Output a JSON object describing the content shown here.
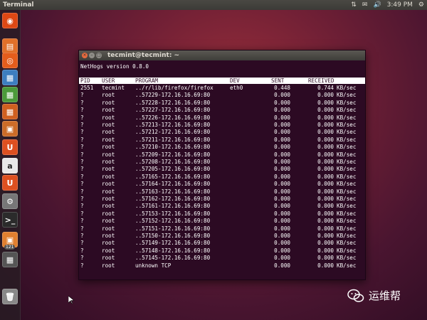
{
  "top_panel": {
    "app_name": "Terminal",
    "clock": "3:49 PM"
  },
  "launcher": {
    "items": [
      {
        "icon": "dash-home-icon",
        "color": "#dd4814"
      },
      {
        "icon": "files-icon",
        "color": "#e0702a"
      },
      {
        "icon": "firefox-icon",
        "color": "#e35d1c"
      },
      {
        "icon": "writer-icon",
        "color": "#3d7ebf"
      },
      {
        "icon": "calc-icon",
        "color": "#4c9a3a"
      },
      {
        "icon": "impress-icon",
        "color": "#d06020"
      },
      {
        "icon": "software-center-icon",
        "color": "#cc6c28"
      },
      {
        "icon": "ubuntu-one-icon",
        "color": "#dd5020"
      },
      {
        "icon": "amazon-icon",
        "color": "#e8e8e8"
      },
      {
        "icon": "ubuntu-one-music-icon",
        "color": "#dd5020"
      },
      {
        "icon": "system-settings-icon",
        "color": "#777777"
      },
      {
        "icon": "terminal-icon",
        "color": "#2b2b2b"
      },
      {
        "icon": "update-manager-icon",
        "color": "#e08030"
      },
      {
        "icon": "workspaces-icon",
        "color": "#555555"
      },
      {
        "icon": "trash-icon",
        "color": "#888888"
      }
    ],
    "badge": "121"
  },
  "terminal": {
    "title": "tecmint@tecmint: ~",
    "version_line": "NetHogs version 0.8.0",
    "columns": [
      "PID",
      "USER",
      "PROGRAM",
      "DEV",
      "SENT",
      "RECEIVED"
    ],
    "rows": [
      {
        "pid": "2551",
        "user": "tecmint",
        "program": "../r/lib/firefox/firefox",
        "dev": "eth0",
        "sent": "0.448",
        "received": "0.744",
        "unit": "KB/sec"
      },
      {
        "pid": "?",
        "user": "root",
        "program": "..57229-172.16.16.69:80",
        "dev": "",
        "sent": "0.000",
        "received": "0.000",
        "unit": "KB/sec"
      },
      {
        "pid": "?",
        "user": "root",
        "program": "..57228-172.16.16.69:80",
        "dev": "",
        "sent": "0.000",
        "received": "0.000",
        "unit": "KB/sec"
      },
      {
        "pid": "?",
        "user": "root",
        "program": "..57227-172.16.16.69:80",
        "dev": "",
        "sent": "0.000",
        "received": "0.000",
        "unit": "KB/sec"
      },
      {
        "pid": "?",
        "user": "root",
        "program": "..57226-172.16.16.69:80",
        "dev": "",
        "sent": "0.000",
        "received": "0.000",
        "unit": "KB/sec"
      },
      {
        "pid": "?",
        "user": "root",
        "program": "..57213-172.16.16.69:80",
        "dev": "",
        "sent": "0.000",
        "received": "0.000",
        "unit": "KB/sec"
      },
      {
        "pid": "?",
        "user": "root",
        "program": "..57212-172.16.16.69:80",
        "dev": "",
        "sent": "0.000",
        "received": "0.000",
        "unit": "KB/sec"
      },
      {
        "pid": "?",
        "user": "root",
        "program": "..57211-172.16.16.69:80",
        "dev": "",
        "sent": "0.000",
        "received": "0.000",
        "unit": "KB/sec"
      },
      {
        "pid": "?",
        "user": "root",
        "program": "..57210-172.16.16.69:80",
        "dev": "",
        "sent": "0.000",
        "received": "0.000",
        "unit": "KB/sec"
      },
      {
        "pid": "?",
        "user": "root",
        "program": "..57209-172.16.16.69:80",
        "dev": "",
        "sent": "0.000",
        "received": "0.000",
        "unit": "KB/sec"
      },
      {
        "pid": "?",
        "user": "root",
        "program": "..57208-172.16.16.69:80",
        "dev": "",
        "sent": "0.000",
        "received": "0.000",
        "unit": "KB/sec"
      },
      {
        "pid": "?",
        "user": "root",
        "program": "..57205-172.16.16.69:80",
        "dev": "",
        "sent": "0.000",
        "received": "0.000",
        "unit": "KB/sec"
      },
      {
        "pid": "?",
        "user": "root",
        "program": "..57165-172.16.16.69:80",
        "dev": "",
        "sent": "0.000",
        "received": "0.000",
        "unit": "KB/sec"
      },
      {
        "pid": "?",
        "user": "root",
        "program": "..57164-172.16.16.69:80",
        "dev": "",
        "sent": "0.000",
        "received": "0.000",
        "unit": "KB/sec"
      },
      {
        "pid": "?",
        "user": "root",
        "program": "..57163-172.16.16.69:80",
        "dev": "",
        "sent": "0.000",
        "received": "0.000",
        "unit": "KB/sec"
      },
      {
        "pid": "?",
        "user": "root",
        "program": "..57162-172.16.16.69:80",
        "dev": "",
        "sent": "0.000",
        "received": "0.000",
        "unit": "KB/sec"
      },
      {
        "pid": "?",
        "user": "root",
        "program": "..57161-172.16.16.69:80",
        "dev": "",
        "sent": "0.000",
        "received": "0.000",
        "unit": "KB/sec"
      },
      {
        "pid": "?",
        "user": "root",
        "program": "..57153-172.16.16.69:80",
        "dev": "",
        "sent": "0.000",
        "received": "0.000",
        "unit": "KB/sec"
      },
      {
        "pid": "?",
        "user": "root",
        "program": "..57152-172.16.16.69:80",
        "dev": "",
        "sent": "0.000",
        "received": "0.000",
        "unit": "KB/sec"
      },
      {
        "pid": "?",
        "user": "root",
        "program": "..57151-172.16.16.69:80",
        "dev": "",
        "sent": "0.000",
        "received": "0.000",
        "unit": "KB/sec"
      },
      {
        "pid": "?",
        "user": "root",
        "program": "..57150-172.16.16.69:80",
        "dev": "",
        "sent": "0.000",
        "received": "0.000",
        "unit": "KB/sec"
      },
      {
        "pid": "?",
        "user": "root",
        "program": "..57149-172.16.16.69:80",
        "dev": "",
        "sent": "0.000",
        "received": "0.000",
        "unit": "KB/sec"
      },
      {
        "pid": "?",
        "user": "root",
        "program": "..57148-172.16.16.69:80",
        "dev": "",
        "sent": "0.000",
        "received": "0.000",
        "unit": "KB/sec"
      },
      {
        "pid": "?",
        "user": "root",
        "program": "..57145-172.16.16.69:80",
        "dev": "",
        "sent": "0.000",
        "received": "0.000",
        "unit": "KB/sec"
      },
      {
        "pid": "?",
        "user": "root",
        "program": "unknown TCP",
        "dev": "",
        "sent": "0.000",
        "received": "0.000",
        "unit": "KB/sec"
      }
    ]
  },
  "watermark": {
    "text": "运维帮"
  }
}
